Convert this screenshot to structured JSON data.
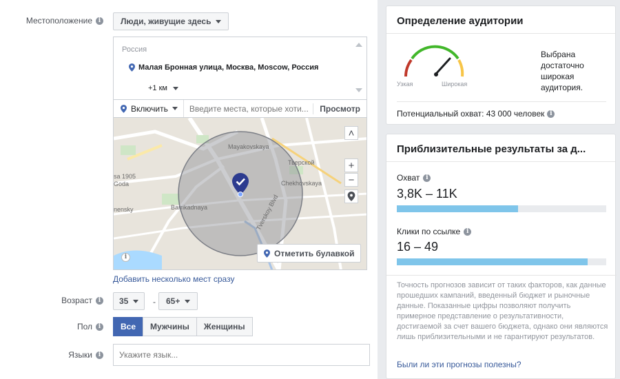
{
  "location": {
    "label": "Местоположение",
    "type_dropdown": "Люди, живущие здесь",
    "country": "Россия",
    "selected_place": "Малая Бронная улица, Москва, Moscow, Россия",
    "radius": "+1 км",
    "include_label": "Включить",
    "search_placeholder": "Введите места, которые хоти...",
    "browse_label": "Просмотр",
    "map": {
      "labels": [
        "Mayakovskaya",
        "Тверской",
        "Chekhovskaya",
        "sa 1905",
        "Goda",
        "Barrikadnaya",
        "nensky",
        "Tverskoy Blvd"
      ],
      "drop_pin_label": "Отметить булавкой"
    },
    "add_many_link": "Добавить несколько мест сразу"
  },
  "age": {
    "label": "Возраст",
    "min": "35",
    "max": "65+",
    "separator": "-"
  },
  "gender": {
    "label": "Пол",
    "options": [
      "Все",
      "Мужчины",
      "Женщины"
    ],
    "selected": "Все"
  },
  "languages": {
    "label": "Языки",
    "placeholder": "Укажите язык..."
  },
  "audience_definition": {
    "title": "Определение аудитории",
    "narrow_label": "Узкая",
    "broad_label": "Широкая",
    "status_text": "Выбрана достаточно широкая аудитория.",
    "potential_reach": "Потенциальный охват: 43 000 человек"
  },
  "estimated_results": {
    "title": "Приблизительные результаты за д...",
    "reach": {
      "label": "Охват",
      "value": "3,8K – 11K",
      "fill": 0.58
    },
    "link_clicks": {
      "label": "Клики по ссылке",
      "value": "16 – 49",
      "fill": 0.91
    },
    "disclaimer": "Точность прогнозов зависит от таких факторов, как данные прошедших кампаний, введенный бюджет и рыночные данные. Показанные цифры позволяют получить примерное представление о результативности, достигаемой за счет вашего бюджета, однако они являются лишь приблизительными и не гарантируют результатов.",
    "feedback_link": "Были ли эти прогнозы полезны?"
  },
  "colors": {
    "accent": "#4267b2",
    "link": "#365899",
    "bar": "#7fc5ea",
    "gauge_red": "#c0392b",
    "gauge_green": "#42b72a",
    "gauge_yellow": "#f7c548"
  }
}
